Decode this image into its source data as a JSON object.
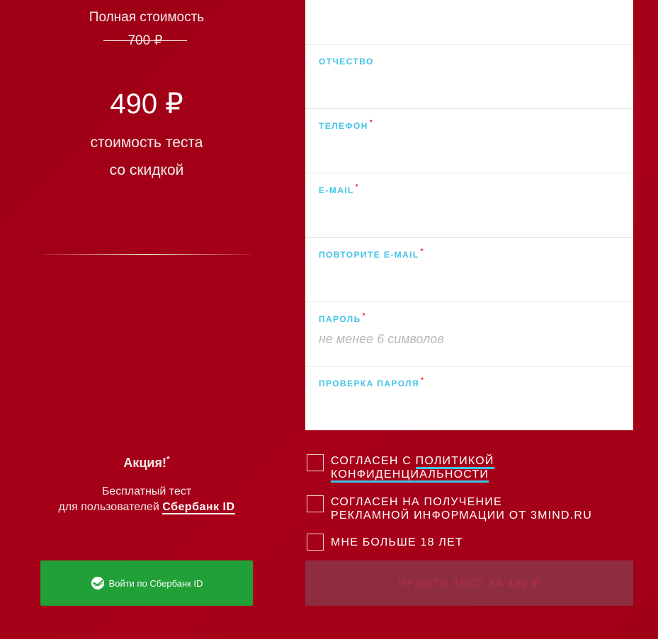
{
  "pricing": {
    "full_label": "Полная стоимость",
    "old_price": "700 ₽",
    "new_price": "490 ₽",
    "discount_line1": "стоимость теста",
    "discount_line2": "со скидкой"
  },
  "promo": {
    "title": "Акция!",
    "star": "*",
    "text_line1": "Бесплатный тест",
    "text_line2": "для пользователей",
    "sber_link": "Сбербанк ID"
  },
  "sber_button": {
    "label": "Войти по Сбербанк ID",
    "color": "#21a038"
  },
  "form": {
    "fields": [
      {
        "label": "",
        "required": false,
        "value": "",
        "placeholder": ""
      },
      {
        "label": "ОТЧЕСТВО",
        "required": false,
        "value": "",
        "placeholder": ""
      },
      {
        "label": "ТЕЛЕФОН",
        "required": true,
        "value": "",
        "placeholder": ""
      },
      {
        "label": "E-MAIL",
        "required": true,
        "value": "",
        "placeholder": ""
      },
      {
        "label": "ПОВТОРИТЕ E-MAIL",
        "required": true,
        "value": "",
        "placeholder": ""
      },
      {
        "label": "ПАРОЛЬ",
        "required": true,
        "value": "",
        "placeholder": "не менее 6 символов"
      },
      {
        "label": "ПРОВЕРКА ПАРОЛЯ",
        "required": true,
        "value": "",
        "placeholder": ""
      }
    ],
    "required_mark": "*"
  },
  "consents": {
    "privacy_prefix": "СОГЛАСЕН С",
    "privacy_link_line1": "ПОЛИТИКОЙ",
    "privacy_link_line2": "КОНФИДЕНЦИАЛЬНОСТИ",
    "ads_line1": "СОГЛАСЕН НА ПОЛУЧЕНИЕ",
    "ads_line2": "РЕКЛАМНОЙ ИНФОРМАЦИИ ОТ 3MIND.RU",
    "age": "МНЕ БОЛЬШЕ 18 ЛЕТ"
  },
  "submit": {
    "label": "ПРОЙТИ ТЕСТ ЗА 490 ₽"
  },
  "colors": {
    "background": "#a3001a",
    "accent": "#41c3e6",
    "required": "#e5223f"
  }
}
